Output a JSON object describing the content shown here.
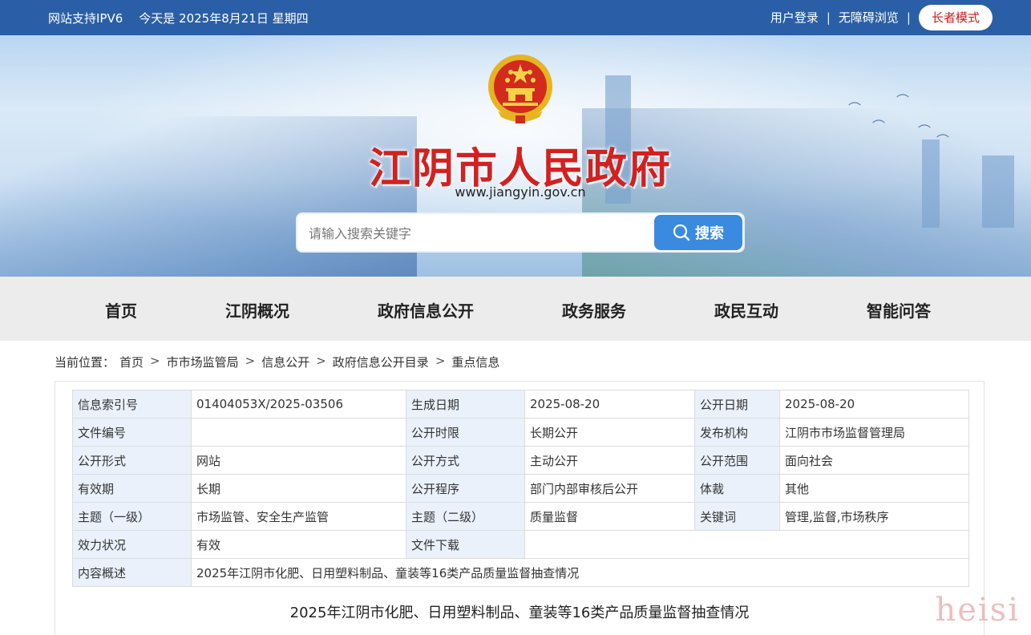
{
  "topbar": {
    "ipv6": "网站支持IPV6",
    "date": "今天是 2025年8月21日 星期四",
    "login": "用户登录",
    "sep": "|",
    "accessible": "无障碍浏览",
    "elder_mode": "长者模式"
  },
  "banner": {
    "title": "江阴市人民政府",
    "url": "www.jiangyin.gov.cn",
    "search_placeholder": "请输入搜索关键字",
    "search_button": "搜索"
  },
  "nav": [
    "首页",
    "江阴概况",
    "政府信息公开",
    "政务服务",
    "政民互动",
    "智能问答"
  ],
  "breadcrumb": {
    "prefix": "当前位置：",
    "items": [
      "首页",
      "市市场监管局",
      "信息公开",
      "政府信息公开目录",
      "重点信息"
    ],
    "arrow": ">"
  },
  "meta": {
    "r0": [
      "信息索引号",
      "01404053X/2025-03506",
      "生成日期",
      "2025-08-20",
      "公开日期",
      "2025-08-20"
    ],
    "r1": [
      "文件编号",
      "",
      "公开时限",
      "长期公开",
      "发布机构",
      "江阴市市场监督管理局"
    ],
    "r2": [
      "公开形式",
      "网站",
      "公开方式",
      "主动公开",
      "公开范围",
      "面向社会"
    ],
    "r3": [
      "有效期",
      "长期",
      "公开程序",
      "部门内部审核后公开",
      "体裁",
      "其他"
    ],
    "r4": [
      "主题（一级）",
      "市场监管、安全生产监管",
      "主题（二级）",
      "质量监督",
      "关键词",
      "管理,监督,市场秩序"
    ],
    "r5": [
      "效力状况",
      "有效",
      "文件下载",
      ""
    ],
    "r6": [
      "内容概述",
      "2025年江阴市化肥、日用塑料制品、童装等16类产品质量监督抽查情况"
    ]
  },
  "doc_title": "2025年江阴市化肥、日用塑料制品、童装等16类产品质量监督抽查情况",
  "watermark": "heisi",
  "colors": {
    "topbar": "#2a5fa7",
    "title_red": "#d42020",
    "search_btn": "#3a8ae0",
    "label_bg": "#eaf1fb"
  }
}
